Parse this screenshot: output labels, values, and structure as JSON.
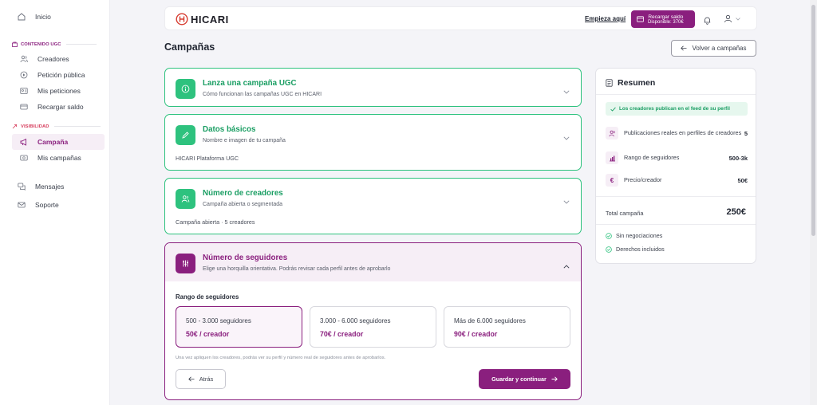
{
  "sidebar": {
    "home": "Inicio",
    "section_ugc": "CONTENIDO UGC",
    "ugc_items": [
      "Creadores",
      "Petición pública",
      "Mis peticiones",
      "Recargar saldo"
    ],
    "section_visibility": "VISIBILIDAD",
    "visibility_items": [
      "Campaña",
      "Mis campañas"
    ],
    "messages": "Mensajes",
    "support": "Soporte",
    "accent": "#8a1f7e",
    "section_ugc_color": "#8a1f7e",
    "section_visibility_color": "#d63b5b"
  },
  "header": {
    "logo": "HICARI",
    "start_link": "Empieza aquí",
    "recharge_label": "Recargar saldo",
    "available": "Disponible: 370€"
  },
  "page": {
    "title": "Campañas",
    "back_button": "Volver a campañas"
  },
  "steps": [
    {
      "title": "Lanza una campaña UGC",
      "subtitle": "Cómo funcionan las campañas UGC en HICARI",
      "icon": "info-icon",
      "value": ""
    },
    {
      "title": "Datos básicos",
      "subtitle": "Nombre e imagen de tu campaña",
      "icon": "pencil-icon",
      "value": "HICARI Plataforma UGC"
    },
    {
      "title": "Número de creadores",
      "subtitle": "Campaña abierta o segmentada",
      "icon": "users-icon",
      "value": "Campaña abierta · 5 creadores"
    }
  ],
  "followers_step": {
    "title": "Número de seguidores",
    "subtitle": "Elige una horquilla orientativa. Podrás revisar cada perfil antes de aprobarlo",
    "range_label": "Rango de seguidores",
    "options": [
      {
        "range": "500 - 3.000 seguidores",
        "price": "50€ / creador",
        "selected": true
      },
      {
        "range": "3.000 - 6.000 seguidores",
        "price": "70€ / creador",
        "selected": false
      },
      {
        "range": "Más de 6.000 seguidores",
        "price": "90€ / creador",
        "selected": false
      }
    ],
    "note": "Una vez apliquen los creadores, podrás ver su perfil y número real de seguidores antes de aprobarlos.",
    "back_button": "Atrás",
    "save_button": "Guardar y continuar"
  },
  "summary": {
    "title": "Resumen",
    "banner": "Los creadores publican en el feed de su perfil",
    "rows": [
      {
        "label": "Publicaciones reales en perfiles de creadores",
        "value": "5",
        "icon": "users-icon"
      },
      {
        "label": "Rango de seguidores",
        "value": "500-3k",
        "icon": "bar-chart-icon"
      },
      {
        "label": "Precio/creador",
        "value": "50€",
        "icon": "euro-icon"
      }
    ],
    "total_label": "Total campaña",
    "total_value": "250€",
    "perks": [
      "Sin negociaciones",
      "Derechos incluidos"
    ]
  }
}
